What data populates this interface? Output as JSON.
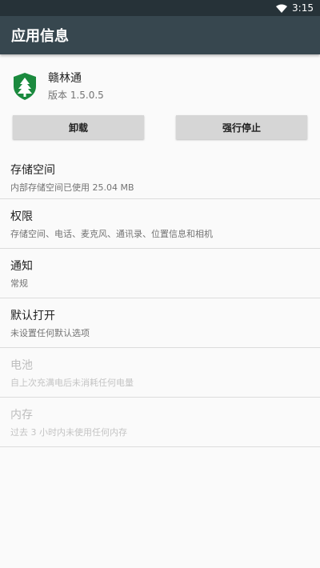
{
  "status_bar": {
    "time": "3:15"
  },
  "app_bar": {
    "title": "应用信息"
  },
  "app": {
    "name": "赣林通",
    "version": "版本 1.5.0.5"
  },
  "buttons": {
    "uninstall": "卸载",
    "force_stop": "强行停止"
  },
  "items": [
    {
      "title": "存储空间",
      "subtitle": "内部存储空间已使用 25.04 MB",
      "enabled": true
    },
    {
      "title": "权限",
      "subtitle": "存储空间、电话、麦克风、通讯录、位置信息和相机",
      "enabled": true
    },
    {
      "title": "通知",
      "subtitle": "常规",
      "enabled": true
    },
    {
      "title": "默认打开",
      "subtitle": "未设置任何默认选项",
      "enabled": true
    },
    {
      "title": "电池",
      "subtitle": "自上次充满电后未消耗任何电量",
      "enabled": false
    },
    {
      "title": "内存",
      "subtitle": "过去 3 小时内未使用任何内存",
      "enabled": false
    }
  ],
  "colors": {
    "status_bar": "#263238",
    "app_bar": "#37474f",
    "app_icon": "#1b8a3e"
  },
  "icons": {
    "wifi": "wifi-icon",
    "app": "tree-shield-icon"
  }
}
